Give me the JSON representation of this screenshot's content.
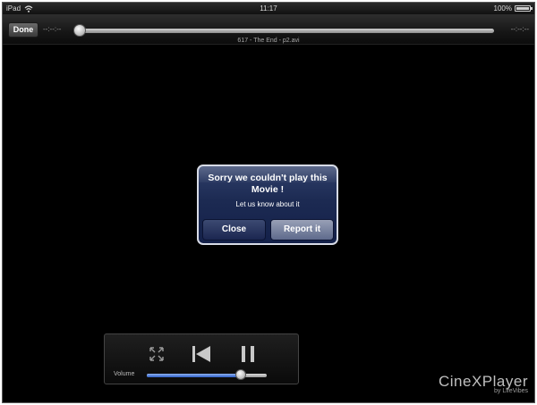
{
  "statusbar": {
    "device": "iPad",
    "time": "11:17",
    "battery": "100%",
    "battery_level": 100
  },
  "toolbar": {
    "done_label": "Done",
    "time_elapsed": "--:--:--",
    "time_remaining": "--:--:--",
    "file_title": "617 - The End - p2.avi",
    "progress": 0
  },
  "alert": {
    "title": "Sorry we couldn't play this Movie !",
    "message": "Let us know about it",
    "close_label": "Close",
    "report_label": "Report it"
  },
  "controls": {
    "volume_label": "Volume",
    "volume_level": 0.78,
    "icons": [
      "fullscreen-icon",
      "previous-icon",
      "pause-icon"
    ]
  },
  "brand": {
    "name": "CineXPlayer",
    "byline": "by LifeVibes"
  }
}
